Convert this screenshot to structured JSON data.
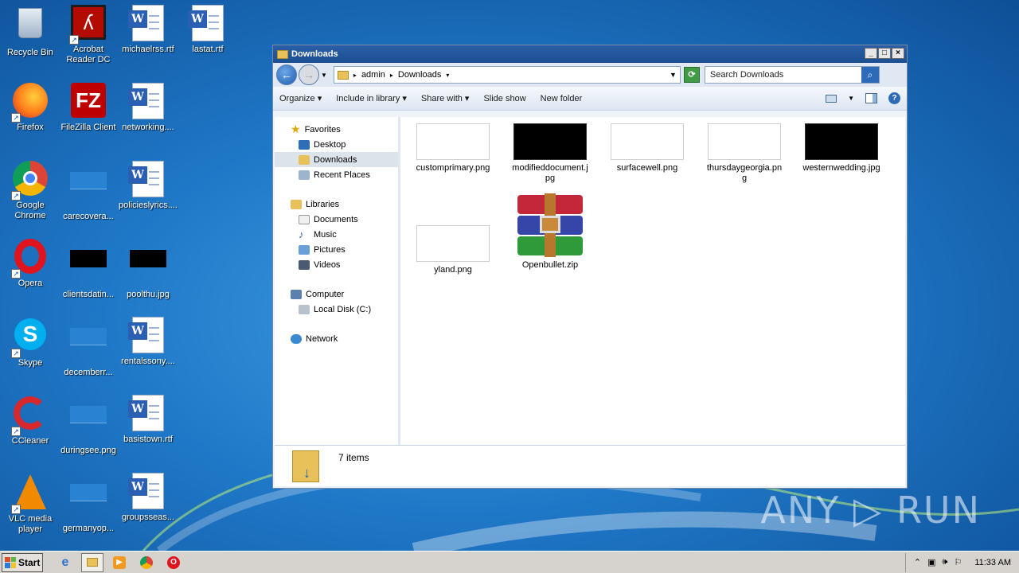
{
  "desktop": {
    "icons": [
      {
        "label": "Recycle Bin",
        "icon": "recycle-bin-icon"
      },
      {
        "label": "Acrobat Reader DC",
        "icon": "acrobat-icon"
      },
      {
        "label": "michaelrss.rtf",
        "icon": "word-document-icon"
      },
      {
        "label": "lastat.rtf",
        "icon": "word-document-icon"
      },
      {
        "label": "Firefox",
        "icon": "firefox-icon"
      },
      {
        "label": "FileZilla Client",
        "icon": "filezilla-icon"
      },
      {
        "label": "networking....",
        "icon": "word-document-icon"
      },
      {
        "label": "Google Chrome",
        "icon": "chrome-icon"
      },
      {
        "label": "carecovera...",
        "icon": "image-thumbnail-icon"
      },
      {
        "label": "policieslyrics....",
        "icon": "word-document-icon"
      },
      {
        "label": "Opera",
        "icon": "opera-icon"
      },
      {
        "label": "clientsdatin...",
        "icon": "image-thumbnail-icon"
      },
      {
        "label": "poolthu.jpg",
        "icon": "image-thumbnail-icon"
      },
      {
        "label": "Skype",
        "icon": "skype-icon"
      },
      {
        "label": "decemberr...",
        "icon": "image-thumbnail-icon"
      },
      {
        "label": "rentalssony....",
        "icon": "word-document-icon"
      },
      {
        "label": "CCleaner",
        "icon": "ccleaner-icon"
      },
      {
        "label": "duringsee.png",
        "icon": "image-thumbnail-icon"
      },
      {
        "label": "basistown.rtf",
        "icon": "word-document-icon"
      },
      {
        "label": "VLC media player",
        "icon": "vlc-icon"
      },
      {
        "label": "germanyop...",
        "icon": "image-thumbnail-icon"
      },
      {
        "label": "groupsseas...",
        "icon": "word-document-icon"
      }
    ]
  },
  "window": {
    "title": "Downloads",
    "controls": {
      "minimize": "_",
      "maximize": "□",
      "close": "×"
    },
    "breadcrumb": [
      "admin",
      "Downloads"
    ],
    "search_placeholder": "Search Downloads",
    "toolbar": {
      "organize": "Organize",
      "include_in_library": "Include in library",
      "share_with": "Share with",
      "slide_show": "Slide show",
      "new_folder": "New folder"
    },
    "nav": {
      "favorites": "Favorites",
      "desktop": "Desktop",
      "downloads": "Downloads",
      "recent_places": "Recent Places",
      "libraries": "Libraries",
      "documents": "Documents",
      "music": "Music",
      "pictures": "Pictures",
      "videos": "Videos",
      "computer": "Computer",
      "local_disk": "Local Disk (C:)",
      "network": "Network"
    },
    "files": [
      {
        "name": "customprimary.png",
        "thumb": "white"
      },
      {
        "name": "modifieddocument.jpg",
        "thumb": "black"
      },
      {
        "name": "surfacewell.png",
        "thumb": "white"
      },
      {
        "name": "thursdaygeorgia.png",
        "thumb": "white"
      },
      {
        "name": "westernwedding.jpg",
        "thumb": "black"
      },
      {
        "name": "yland.png",
        "thumb": "white"
      },
      {
        "name": "Openbullet.zip",
        "thumb": "winrar-archive-icon"
      }
    ],
    "status_count": "7 items"
  },
  "watermark": "ANY ▷ RUN",
  "taskbar": {
    "start_label": "Start",
    "clock": "11:33 AM"
  }
}
